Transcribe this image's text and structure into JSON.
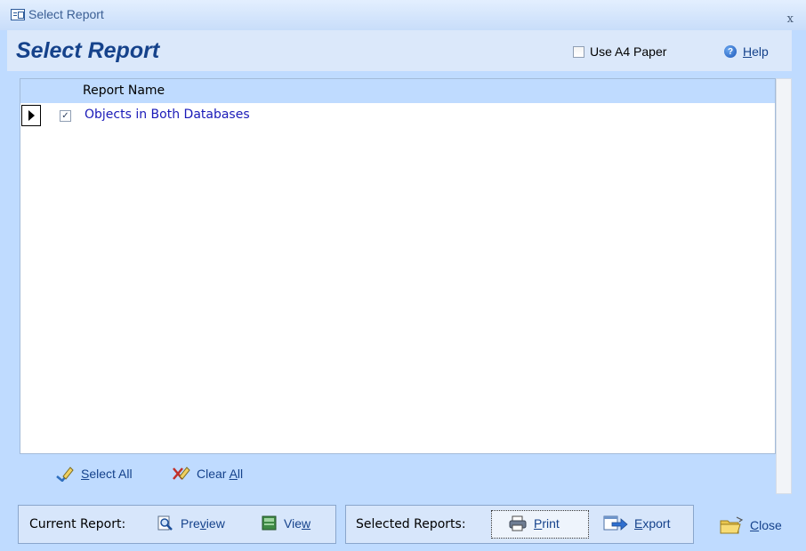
{
  "window": {
    "title": "Select Report",
    "close_glyph": "x"
  },
  "header": {
    "title": "Select Report",
    "a4_label": "Use A4 Paper",
    "a4_checked": false,
    "help_prefix": "",
    "help_hotkey": "H",
    "help_rest": "elp"
  },
  "grid": {
    "column_header": "Report Name",
    "rows": [
      {
        "checked": true,
        "label": "Objects in Both Databases"
      }
    ]
  },
  "selection": {
    "select_all": {
      "pre": "",
      "hotkey": "S",
      "post": "elect All"
    },
    "clear_all": {
      "pre": "Clear ",
      "hotkey": "A",
      "post": "ll"
    }
  },
  "current_report": {
    "label": "Current Report:",
    "preview": {
      "pre": "Pre",
      "hotkey": "v",
      "post": "iew"
    },
    "view": {
      "pre": "Vie",
      "hotkey": "w",
      "post": ""
    }
  },
  "selected_reports": {
    "label": "Selected Reports:",
    "print": {
      "pre": "",
      "hotkey": "P",
      "post": "rint"
    },
    "export": {
      "pre": "",
      "hotkey": "E",
      "post": "xport"
    }
  },
  "close": {
    "pre": "",
    "hotkey": "C",
    "post": "lose"
  },
  "icons": {
    "app": "form-window-icon",
    "help": "help-icon",
    "select_all": "pencil-check-icon",
    "clear_all": "pencil-clear-icon",
    "preview": "magnifier-page-icon",
    "view": "report-view-icon",
    "print": "printer-icon",
    "export": "export-arrow-icon",
    "close": "folder-close-icon"
  },
  "colors": {
    "frame": "#bfdbff",
    "header": "#dbe8fa",
    "title": "#15428b",
    "link": "#1a1ab8"
  }
}
